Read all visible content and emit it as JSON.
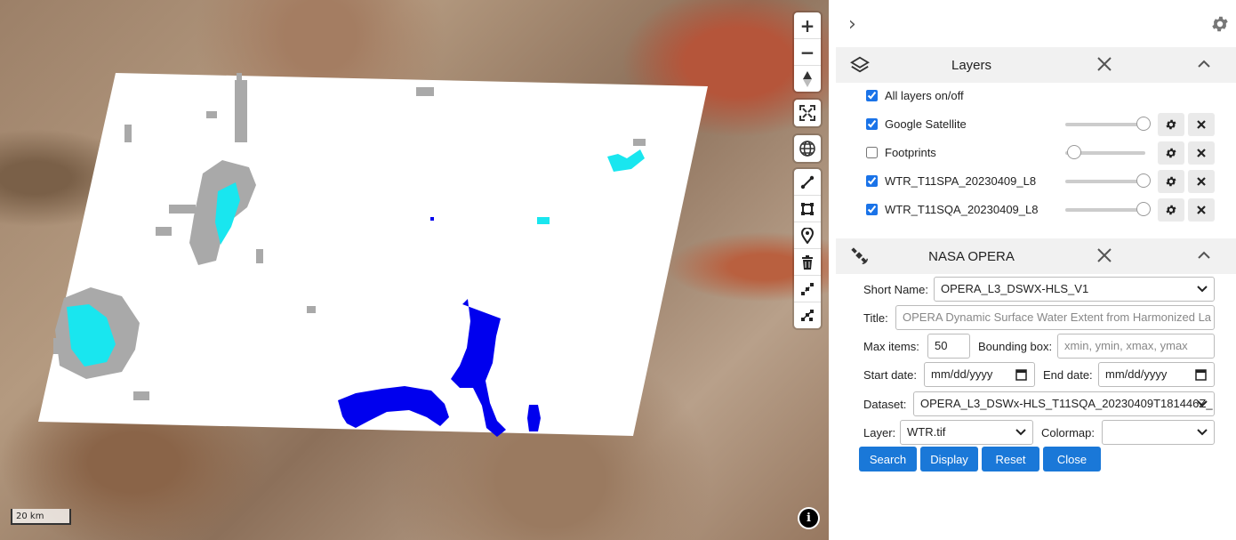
{
  "map": {
    "zoom_in": "+",
    "zoom_out": "−",
    "scale_label": "20 km",
    "info_label": "i",
    "icons": [
      "plus-icon",
      "minus-icon",
      "compass-icon",
      "fullscreen-icon",
      "globe-icon",
      "draw-line-icon",
      "draw-rectangle-icon",
      "marker-icon",
      "trash-icon",
      "draw-points-icon",
      "draw-points-icon-2"
    ]
  },
  "panel": {
    "layers": {
      "title": "Layers",
      "all_toggle": "All layers on/off",
      "items": [
        {
          "label": "Google Satellite",
          "checked": true,
          "opacity": 1.0
        },
        {
          "label": "Footprints",
          "checked": false,
          "opacity": 0.2
        },
        {
          "label": "WTR_T11SPA_20230409_L8",
          "checked": true,
          "opacity": 1.0
        },
        {
          "label": "WTR_T11SQA_20230409_L8",
          "checked": true,
          "opacity": 1.0
        }
      ]
    },
    "opera": {
      "title": "NASA OPERA",
      "short_name_label": "Short Name:",
      "short_name_value": "OPERA_L3_DSWX-HLS_V1",
      "title_label": "Title:",
      "title_value": "OPERA Dynamic Surface Water Extent from Harmonized La",
      "max_items_label": "Max items:",
      "max_items_value": "50",
      "bbox_label": "Bounding box:",
      "bbox_placeholder": "xmin, ymin, xmax, ymax",
      "start_label": "Start date:",
      "start_value": "mm/dd/yyyy",
      "end_label": "End date:",
      "end_value": "mm/dd/yyyy",
      "dataset_label": "Dataset:",
      "dataset_value": "OPERA_L3_DSWx-HLS_T11SQA_20230409T181446Z_",
      "layer_label": "Layer:",
      "layer_value": "WTR.tif",
      "colormap_label": "Colormap:",
      "colormap_value": "",
      "buttons": {
        "search": "Search",
        "display": "Display",
        "reset": "Reset",
        "close": "Close"
      }
    }
  },
  "colors": {
    "accent": "#1a78d8",
    "water": "#0000ff",
    "partial_water": "#00ffff",
    "cloud": "#a9a9a9"
  }
}
